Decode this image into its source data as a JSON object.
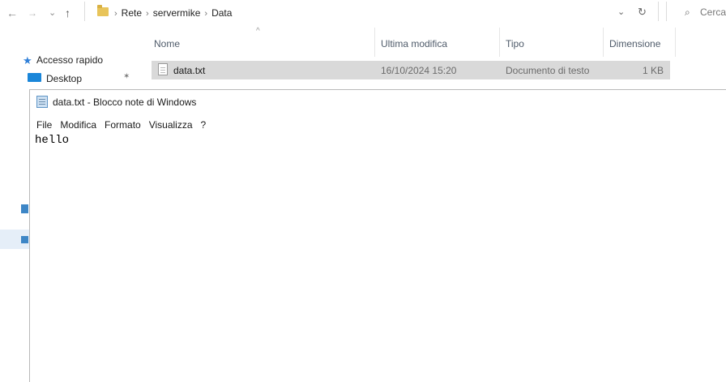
{
  "explorer": {
    "nav": {
      "back": "←",
      "forward": "→",
      "recent": "⌄",
      "up": "↑"
    },
    "breadcrumb": [
      "Rete",
      "servermike",
      "Data"
    ],
    "address_dropdown": "⌄",
    "refresh": "↻",
    "search_placeholder": "Cerca",
    "search_icon": "⌕",
    "columns": {
      "name": "Nome",
      "modified": "Ultima modifica",
      "type": "Tipo",
      "size": "Dimensione"
    },
    "sort_indicator": "^",
    "files": [
      {
        "name": "data.txt",
        "modified": "16/10/2024 15:20",
        "type": "Documento di testo",
        "size": "1 KB"
      }
    ],
    "navigation_pane": {
      "quick_access": "Accesso rapido",
      "desktop": "Desktop",
      "pin_icon": "✶"
    }
  },
  "notepad": {
    "title": "data.txt - Blocco note di Windows",
    "menu": [
      "File",
      "Modifica",
      "Formato",
      "Visualizza",
      "?"
    ],
    "content": "hello"
  },
  "colors": {
    "selection": "#d9d9d9",
    "accent": "#1a86d9",
    "folder": "#e8c45a"
  }
}
